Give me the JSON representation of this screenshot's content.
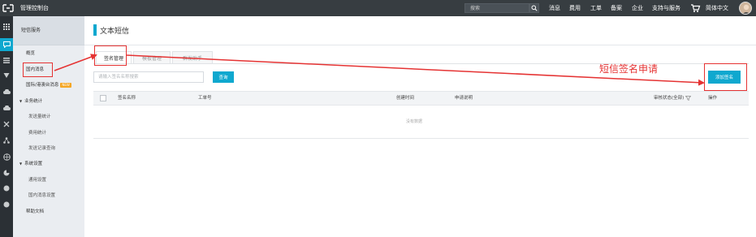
{
  "topbar": {
    "title": "管理控制台",
    "search_placeholder": "搜索",
    "nav": [
      "消息",
      "费用",
      "工单",
      "备案",
      "企业",
      "支持与服务",
      "简体中文"
    ]
  },
  "rail_icons": [
    "grid-icon",
    "message-icon",
    "list-icon",
    "shield-icon",
    "cloud-icon",
    "cloud-upload-icon",
    "tools-icon",
    "network-icon",
    "globe-icon",
    "cycle-icon",
    "dot-icon",
    "dot-icon"
  ],
  "sidebar": {
    "title": "短信服务",
    "items": {
      "overview": "概览",
      "domestic": "国内消息",
      "international": "国际/港澳台消息",
      "new_badge": "NEW",
      "stats_group": "业务统计",
      "send_stats": "发送量统计",
      "cost_stats": "费用统计",
      "send_log": "发送记录查询",
      "settings_group": "系统设置",
      "general_settings": "通用设置",
      "domestic_settings": "国内消息设置",
      "help": "帮助文档"
    }
  },
  "main": {
    "page_title": "文本短信",
    "tabs": [
      "签名管理",
      "模板管理",
      "群发助手"
    ],
    "filter_placeholder": "请输入签名名称搜索",
    "query_button": "查询",
    "add_button": "添加签名",
    "columns": {
      "name": "签名名称",
      "ticket": "工单号",
      "created": "创建时间",
      "reason": "申请说明",
      "status": "审核状态(全部)",
      "actions": "操作"
    },
    "empty_text": "没有数据"
  },
  "annotation": {
    "text": "短信签名申请",
    "color": "#e53333"
  },
  "colors": {
    "accent": "#0fa8cf",
    "topbar": "#373d41",
    "rail": "#2b3035",
    "sidebar": "#eaedf1"
  }
}
